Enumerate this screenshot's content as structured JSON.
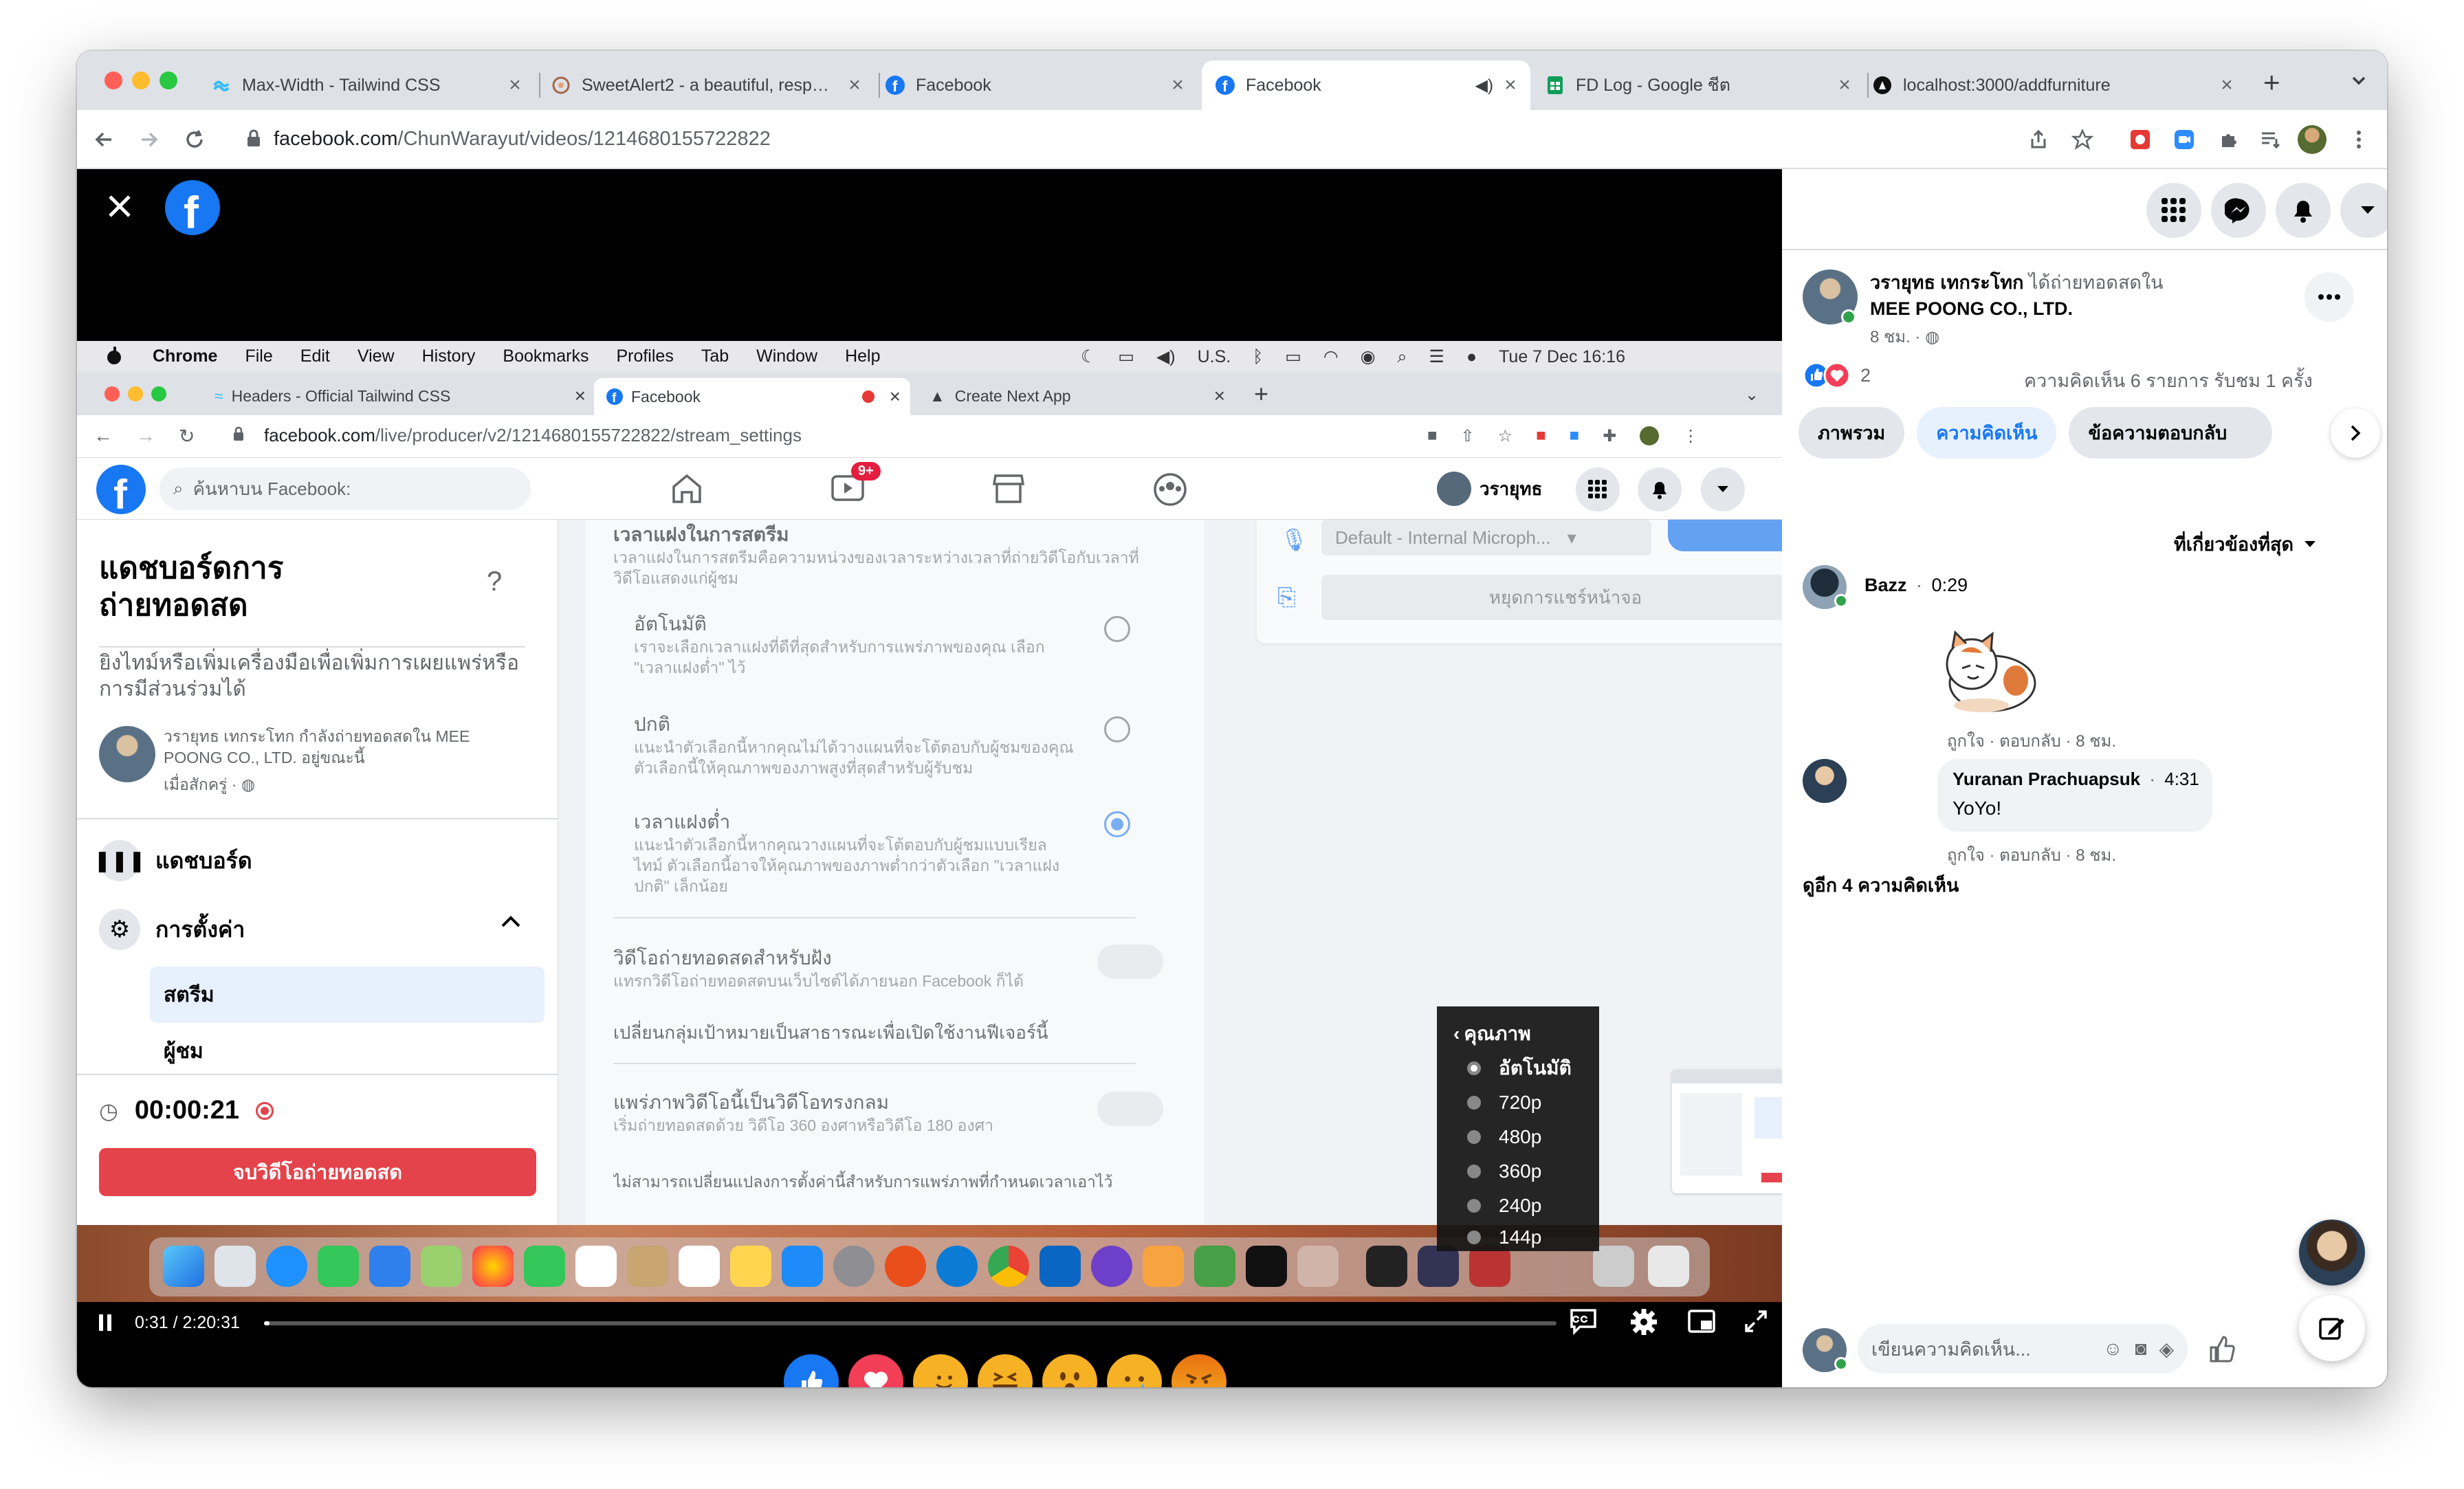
{
  "browser": {
    "tabs": [
      {
        "title": "Max-Width - Tailwind CSS",
        "icon": "tailwind-icon"
      },
      {
        "title": "SweetAlert2 - a beautiful, resp…",
        "icon": "sweetalert-icon"
      },
      {
        "title": "Facebook",
        "icon": "facebook-icon"
      },
      {
        "title": "Facebook",
        "icon": "facebook-icon",
        "active": true,
        "audio": "speaker-icon"
      },
      {
        "title": "FD Log - Google ชีต",
        "icon": "sheets-icon"
      },
      {
        "title": "localhost:3000/addfurniture",
        "icon": "nextjs-icon"
      }
    ],
    "close_glyph": "×",
    "new_tab_glyph": "+",
    "url_host": "facebook.com",
    "url_path": "/ChunWarayut/videos/1214680155722822"
  },
  "inner": {
    "menubar": [
      "Chrome",
      "File",
      "Edit",
      "View",
      "History",
      "Bookmarks",
      "Profiles",
      "Tab",
      "Window",
      "Help"
    ],
    "clock": "Tue 7 Dec  16:16",
    "input_source": "U.S.",
    "tabs": [
      "Headers - Official Tailwind CSS",
      "Facebook",
      "Create Next App"
    ],
    "url_host": "facebook.com",
    "url_path": "/live/producer/v2/1214680155722822/stream_settings",
    "search_placeholder": "ค้นหาบน Facebook:",
    "notif_badge": "9+",
    "profile_name": "วรายุทธ",
    "left_title": "แดชบอร์ดการถ่ายทอดสด",
    "left_subtitle": "ยิงไทม์หรือเพิ่มเครื่องมือเพื่อเพิ่มการเผยแพร่หรือการมีส่วนร่วมได้",
    "status_text": "วรายุทธ เทกระโทก กำลังถ่ายทอดสดใน MEE POONG CO., LTD. อยู่ขณะนี้",
    "status_time": "เมื่อสักครู่ · ",
    "nav_dashboard": "แดชบอร์ด",
    "nav_settings": "การตั้งค่า",
    "nav_stream": "สตรีม",
    "nav_viewers": "ผู้ชม",
    "elapsed": "00:00:21",
    "end_button": "จบวิดีโอถ่ายทอดสด",
    "mid": {
      "section_title": "เวลาแฝงในการสตรีม",
      "section_desc": "เวลาแฝงในการสตรีมคือความหน่วงของเวลาระหว่างเวลาที่ถ่ายวิดีโอกับเวลาที่วิดีโอแสดงแก่ผู้ชม",
      "opt1_title": "อัตโนมัติ",
      "opt1_desc": "เราจะเลือกเวลาแฝงที่ดีที่สุดสำหรับการแพร่ภาพของคุณ เลือก \"เวลาแฝงต่ำ\" ไว้",
      "opt2_title": "ปกติ",
      "opt2_desc": "แนะนำตัวเลือกนี้หากคุณไม่ได้วางแผนที่จะโต้ตอบกับผู้ชมของคุณ ตัวเลือกนี้ให้คุณภาพของภาพสูงที่สุดสำหรับผู้รับชม",
      "opt3_title": "เวลาแฝงต่ำ",
      "opt3_desc": "แนะนำตัวเลือกนี้หากคุณวางแผนที่จะโต้ตอบกับผู้ชมแบบเรียลไทม์ ตัวเลือกนี้อาจให้คุณภาพของภาพต่ำกว่าตัวเลือก \"เวลาแฝงปกติ\" เล็กน้อย",
      "embed_title": "วิดีโอถ่ายทอดสดสำหรับฝัง",
      "embed_desc": "แทรกวิดีโอถ่ายทอดสดบนเว็บไซต์ได้ภายนอก Facebook ก็ได้",
      "embed_link": "เปลี่ยนกลุ่มเป้าหมายเป็นสาธารณะเพื่อเปิดใช้งานฟีเจอร์นี้",
      "vr_title": "แพร่ภาพวิดีโอนี้เป็นวิดีโอทรงกลม",
      "vr_desc": "เริ่มถ่ายทอดสดด้วย วิดีโอ 360 องศาหรือวิดีโอ 180 องศา",
      "vr_note": "ไม่สามารถเปลี่ยนแปลงการตั้งค่านี้สำหรับการแพร่ภาพที่กำหนดเวลาเอาไว้"
    },
    "mic_select": "Default - Internal Microph...",
    "stop_share": "หยุดการแชร์หน้าจอ"
  },
  "quality_menu": {
    "title": "คุณภาพ",
    "options": [
      "อัตโนมัติ",
      "720p",
      "480p",
      "360p",
      "240p",
      "144p"
    ],
    "selected": 0
  },
  "player": {
    "time": "0:31 / 2:20:31",
    "progress": 0.0037
  },
  "reactions": [
    {
      "name": "like",
      "color": "#1877f2",
      "glyph": "👍"
    },
    {
      "name": "love",
      "color": "#f33e58",
      "glyph": "❤"
    },
    {
      "name": "care",
      "color": "#f7b125",
      "glyph": "🤗"
    },
    {
      "name": "haha",
      "color": "#f7b125",
      "glyph": "😆"
    },
    {
      "name": "wow",
      "color": "#f7b125",
      "glyph": "😮"
    },
    {
      "name": "sad",
      "color": "#f7b125",
      "glyph": "😢"
    },
    {
      "name": "angry",
      "color": "#e9710f",
      "glyph": "😡"
    }
  ],
  "side": {
    "author": "วรายุทธ เทกระโทก",
    "action": " ได้ถ่ายทอดสดใน",
    "page": "MEE POONG CO., LTD.",
    "time": "8 ชม. · ",
    "reaction_count": "2",
    "stats": "ความคิดเห็น 6 รายการ  รับชม 1 ครั้ง",
    "tabs": [
      "ภาพรวม",
      "ความคิดเห็น",
      "ข้อความตอบกลับ"
    ],
    "sort": "ที่เกี่ยวข้องที่สุด",
    "comments": [
      {
        "name": "Bazz",
        "time": "0:29",
        "text": "",
        "meta": "ถูกใจ · ตอบกลับ · 8 ชม."
      },
      {
        "name": "Yuranan Prachuapsuk",
        "time": "4:31",
        "text": "YoYo!",
        "meta": "ถูกใจ · ตอบกลับ · 8 ชม."
      }
    ],
    "more": "ดูอีก 4 ความคิดเห็น",
    "composer_placeholder": "เขียนความคิดเห็น..."
  },
  "colors": {
    "fb_blue": "#1877f2",
    "end_red": "#e4434b",
    "tab_bg": "#dee1e6"
  }
}
